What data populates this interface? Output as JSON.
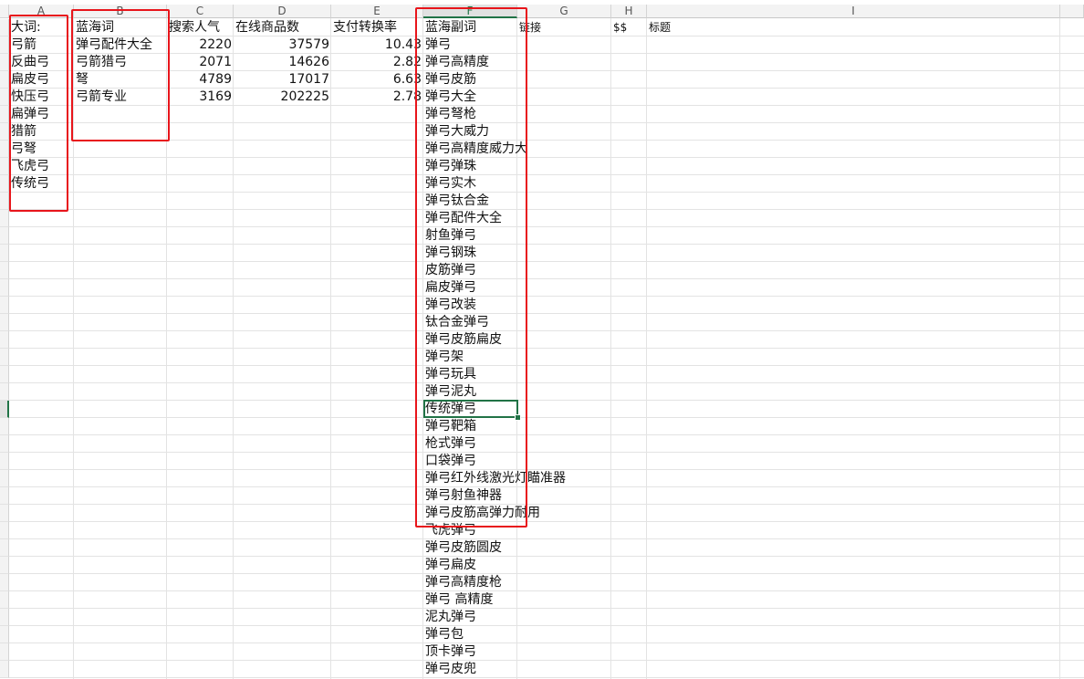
{
  "sheet": {
    "columns": [
      "A",
      "B",
      "C",
      "D",
      "E",
      "F",
      "G",
      "H",
      "I"
    ],
    "active_column": "F",
    "header_row": {
      "A": "大词:",
      "B": "蓝海词",
      "C": "搜索人气",
      "D": "在线商品数",
      "E": "支付转换率",
      "F": "蓝海副词",
      "G": "链接",
      "H": "$$",
      "I": "标题"
    },
    "big_words": [
      "弓箭",
      "反曲弓",
      "扁皮弓",
      "快压弓",
      "扁弹弓",
      "猎箭",
      "弓弩",
      "飞虎弓",
      "传统弓"
    ],
    "blue_ocean_rows": [
      {
        "word": "弹弓配件大全",
        "search": "2220",
        "products": "37579",
        "conversion": "10.43"
      },
      {
        "word": "弓箭猎弓",
        "search": "2071",
        "products": "14626",
        "conversion": "2.82"
      },
      {
        "word": "弩",
        "search": "4789",
        "products": "17017",
        "conversion": "6.63"
      },
      {
        "word": "弓箭专业",
        "search": "3169",
        "products": "202225",
        "conversion": "2.78"
      }
    ],
    "secondary_words": [
      "弹弓",
      "弹弓高精度",
      "弹弓皮筋",
      "弹弓大全",
      "弹弓弩枪",
      "弹弓大威力",
      "弹弓高精度威力大",
      "弹弓弹珠",
      "弹弓实木",
      "弹弓钛合金",
      "弹弓配件大全",
      "射鱼弹弓",
      "弹弓钢珠",
      "皮筋弹弓",
      "扁皮弹弓",
      "弹弓改装",
      "钛合金弹弓",
      "弹弓皮筋扁皮",
      "弹弓架",
      "弹弓玩具",
      "弹弓泥丸",
      "传统弹弓",
      "弹弓靶箱",
      "枪式弹弓",
      "口袋弹弓",
      "弹弓红外线激光灯瞄准器",
      "弹弓射鱼神器",
      "弹弓皮筋高弹力耐用",
      "飞虎弹弓",
      "弹弓皮筋圆皮",
      "弹弓扁皮",
      "弹弓高精度枪",
      "弹弓 高精度",
      "泥丸弹弓",
      "弹弓包",
      "顶卡弹弓",
      "弹弓皮兜"
    ],
    "selected_cell": "F23",
    "selected_value": "传统弹弓"
  },
  "colors": {
    "accent": "#217346",
    "annotation": "#e8151b",
    "gridline": "#e3e3e3"
  }
}
